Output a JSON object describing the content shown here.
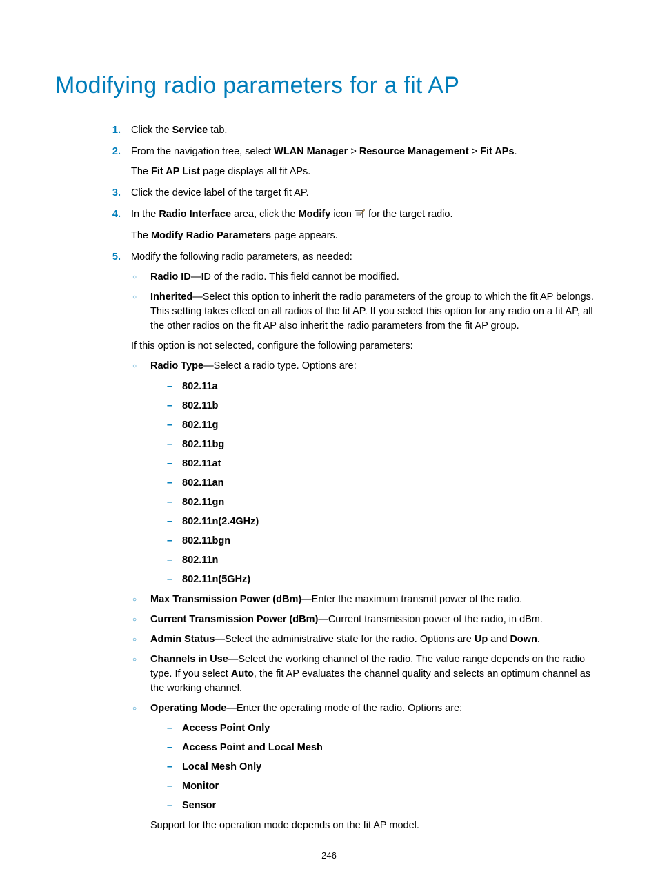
{
  "title": "Modifying radio parameters for a fit AP",
  "steps": {
    "s1": {
      "num": "1.",
      "pre": "Click the ",
      "b1": "Service",
      "post": " tab."
    },
    "s2": {
      "num": "2.",
      "pre": "From the navigation tree, select ",
      "b1": "WLAN Manager",
      "sep1": " > ",
      "b2": "Resource Management",
      "sep2": " > ",
      "b3": "Fit APs",
      "post": ".",
      "line2_pre": "The ",
      "line2_b": "Fit AP List",
      "line2_post": " page displays all fit APs."
    },
    "s3": {
      "num": "3.",
      "text": "Click the device label of the target fit AP."
    },
    "s4": {
      "num": "4.",
      "pre": "In the ",
      "b1": "Radio Interface",
      "mid": " area, click the ",
      "b2": "Modify",
      "post_icon": " icon ",
      "after_icon": " for the target radio.",
      "line2_pre": "The ",
      "line2_b": "Modify Radio Parameters",
      "line2_post": " page appears."
    },
    "s5": {
      "num": "5.",
      "intro": "Modify the following radio parameters, as needed:",
      "radio_id": {
        "label": "Radio ID",
        "desc": "—ID of the radio. This field cannot be modified."
      },
      "inherited": {
        "label": "Inherited",
        "desc": "—Select this option to inherit the radio parameters of the group to which the fit AP belongs. This setting takes effect on all radios of the fit AP. If you select this option for any radio on a fit AP, all the other radios on the fit AP also inherit the radio parameters from the fit AP group."
      },
      "if_not": "If this option is not selected, configure the following parameters:",
      "radio_type": {
        "label": "Radio Type",
        "desc": "—Select a radio type. Options are:"
      },
      "types": [
        "802.11a",
        "802.11b",
        "802.11g",
        "802.11bg",
        "802.11at",
        "802.11an",
        "802.11gn",
        "802.11n(2.4GHz)",
        "802.11bgn",
        "802.11n",
        "802.11n(5GHz)"
      ],
      "max_tx": {
        "label": "Max Transmission Power (dBm)",
        "desc": "—Enter the maximum transmit power of the radio."
      },
      "cur_tx": {
        "label": "Current Transmission Power (dBm)",
        "desc": "—Current transmission power of the radio, in dBm."
      },
      "admin": {
        "label": "Admin Status",
        "pre": "—Select the administrative state for the radio. Options are ",
        "opt1": "Up",
        "mid": " and ",
        "opt2": "Down",
        "post": "."
      },
      "channels": {
        "label": "Channels in Use",
        "pre": "—Select the working channel of the radio. The value range depends on the radio type. If you select ",
        "auto": "Auto",
        "post": ", the fit AP evaluates the channel quality and selects an optimum channel as the working channel."
      },
      "op_mode": {
        "label": "Operating Mode",
        "desc": "—Enter the operating mode of the radio. Options are:"
      },
      "modes": [
        "Access Point Only",
        "Access Point and Local Mesh",
        "Local Mesh Only",
        "Monitor",
        "Sensor"
      ],
      "support": "Support for the operation mode depends on the fit AP model."
    }
  },
  "page_number": "246"
}
